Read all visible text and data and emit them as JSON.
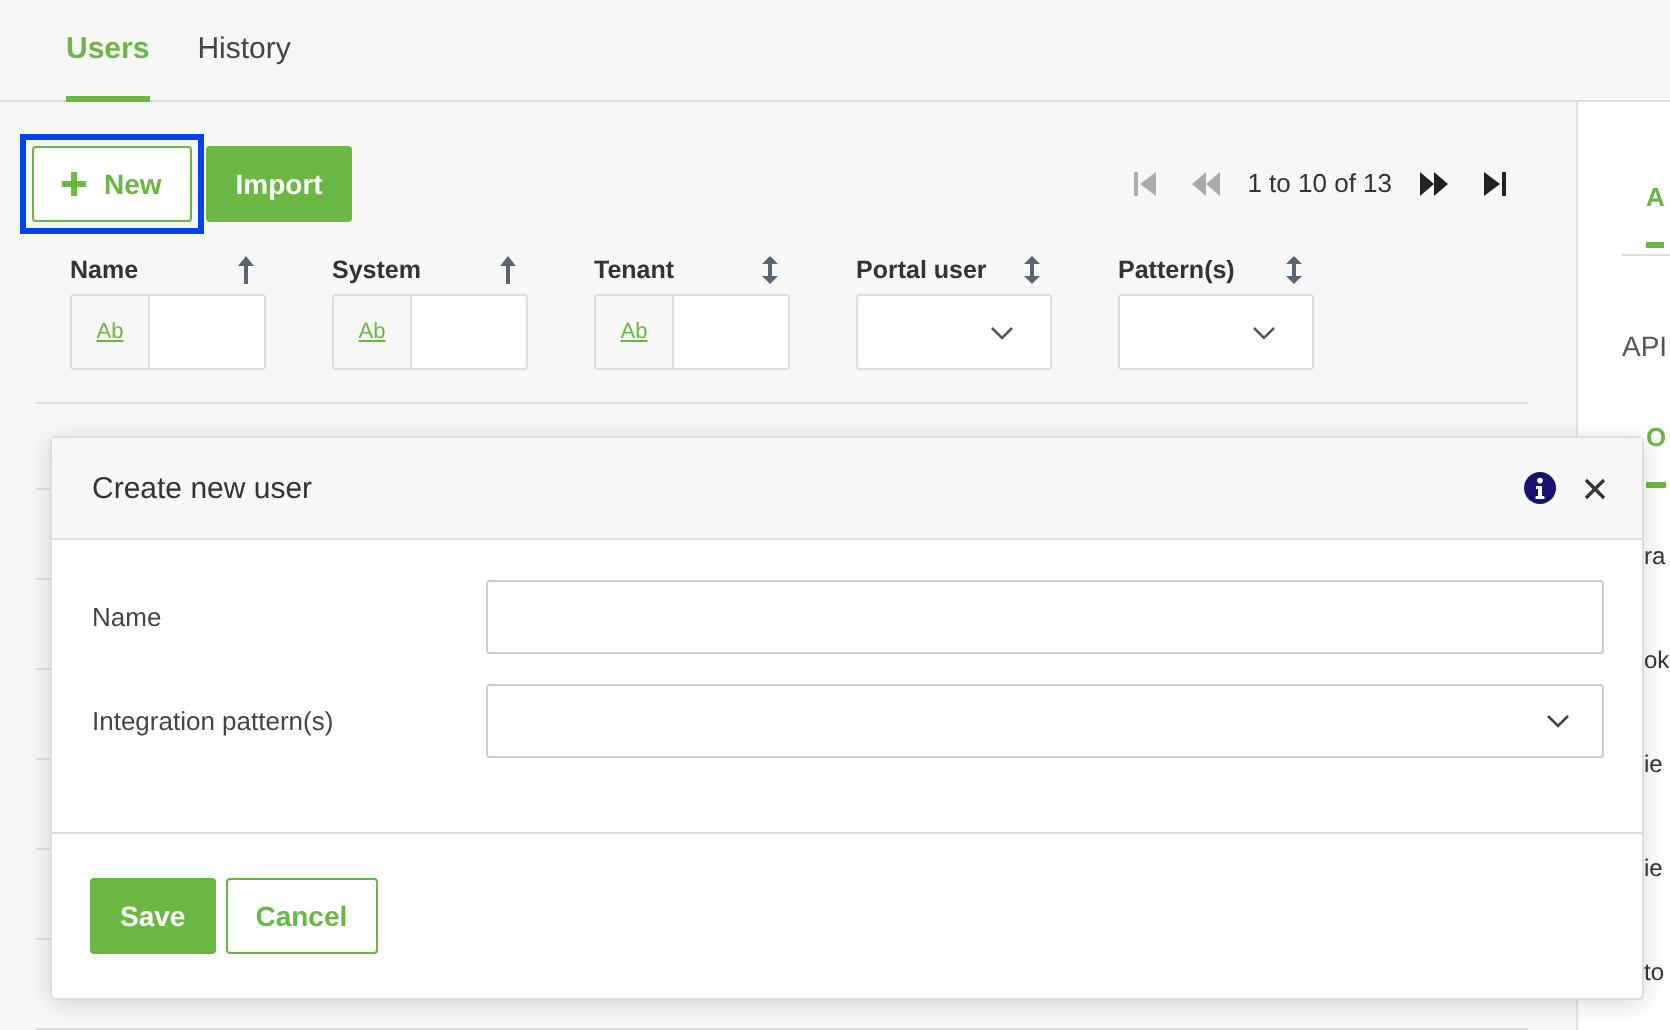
{
  "tabs": [
    {
      "label": "Users",
      "selected": true
    },
    {
      "label": "History",
      "selected": false
    }
  ],
  "toolbar": {
    "new_button": {
      "label": "New",
      "focused": true
    },
    "import_button": {
      "label": "Import"
    }
  },
  "pager": {
    "range": "1 to 10 of 13",
    "buttons": [
      {
        "kind": "first",
        "disabled": true
      },
      {
        "kind": "prev",
        "disabled": true
      },
      {
        "kind": "next",
        "disabled": false
      },
      {
        "kind": "last",
        "disabled": false
      }
    ]
  },
  "columns": [
    {
      "name": "Name",
      "sorted": true,
      "kind": "text",
      "filter_label": "Ab"
    },
    {
      "name": "System",
      "sorted": true,
      "kind": "text",
      "filter_label": "Ab"
    },
    {
      "name": "Tenant",
      "sorted": false,
      "kind": "text",
      "filter_label": "Ab"
    },
    {
      "name": "Portal user",
      "sorted": false,
      "kind": "select"
    },
    {
      "name": "Pattern(s)",
      "sorted": false,
      "kind": "select"
    }
  ],
  "side_panel": {
    "tabs": [
      {
        "label": "A",
        "selected": true
      }
    ],
    "text": "API",
    "subtabs": [
      {
        "label": "O",
        "selected": true
      }
    ],
    "items": [
      "ra",
      "ok",
      "ie",
      "ie",
      "to"
    ]
  },
  "dialog": {
    "title": "Create new user",
    "fields": [
      {
        "label": "Name",
        "kind": "text"
      },
      {
        "label": "Integration pattern(s)",
        "kind": "select"
      }
    ],
    "save": "Save",
    "cancel": "Cancel"
  }
}
